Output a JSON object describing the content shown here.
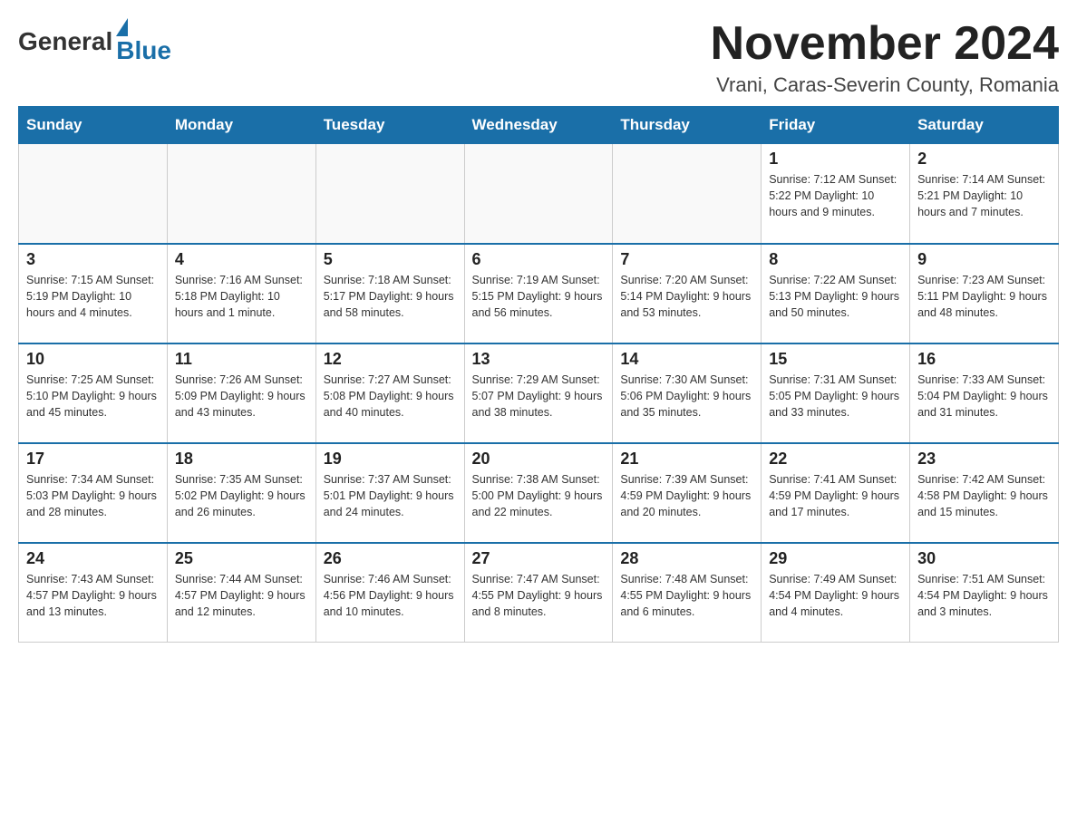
{
  "logo": {
    "general": "General",
    "blue": "Blue",
    "arrow": "▶"
  },
  "title": {
    "month": "November 2024",
    "location": "Vrani, Caras-Severin County, Romania"
  },
  "weekdays": [
    "Sunday",
    "Monday",
    "Tuesday",
    "Wednesday",
    "Thursday",
    "Friday",
    "Saturday"
  ],
  "weeks": [
    [
      {
        "day": "",
        "info": ""
      },
      {
        "day": "",
        "info": ""
      },
      {
        "day": "",
        "info": ""
      },
      {
        "day": "",
        "info": ""
      },
      {
        "day": "",
        "info": ""
      },
      {
        "day": "1",
        "info": "Sunrise: 7:12 AM\nSunset: 5:22 PM\nDaylight: 10 hours\nand 9 minutes."
      },
      {
        "day": "2",
        "info": "Sunrise: 7:14 AM\nSunset: 5:21 PM\nDaylight: 10 hours\nand 7 minutes."
      }
    ],
    [
      {
        "day": "3",
        "info": "Sunrise: 7:15 AM\nSunset: 5:19 PM\nDaylight: 10 hours\nand 4 minutes."
      },
      {
        "day": "4",
        "info": "Sunrise: 7:16 AM\nSunset: 5:18 PM\nDaylight: 10 hours\nand 1 minute."
      },
      {
        "day": "5",
        "info": "Sunrise: 7:18 AM\nSunset: 5:17 PM\nDaylight: 9 hours\nand 58 minutes."
      },
      {
        "day": "6",
        "info": "Sunrise: 7:19 AM\nSunset: 5:15 PM\nDaylight: 9 hours\nand 56 minutes."
      },
      {
        "day": "7",
        "info": "Sunrise: 7:20 AM\nSunset: 5:14 PM\nDaylight: 9 hours\nand 53 minutes."
      },
      {
        "day": "8",
        "info": "Sunrise: 7:22 AM\nSunset: 5:13 PM\nDaylight: 9 hours\nand 50 minutes."
      },
      {
        "day": "9",
        "info": "Sunrise: 7:23 AM\nSunset: 5:11 PM\nDaylight: 9 hours\nand 48 minutes."
      }
    ],
    [
      {
        "day": "10",
        "info": "Sunrise: 7:25 AM\nSunset: 5:10 PM\nDaylight: 9 hours\nand 45 minutes."
      },
      {
        "day": "11",
        "info": "Sunrise: 7:26 AM\nSunset: 5:09 PM\nDaylight: 9 hours\nand 43 minutes."
      },
      {
        "day": "12",
        "info": "Sunrise: 7:27 AM\nSunset: 5:08 PM\nDaylight: 9 hours\nand 40 minutes."
      },
      {
        "day": "13",
        "info": "Sunrise: 7:29 AM\nSunset: 5:07 PM\nDaylight: 9 hours\nand 38 minutes."
      },
      {
        "day": "14",
        "info": "Sunrise: 7:30 AM\nSunset: 5:06 PM\nDaylight: 9 hours\nand 35 minutes."
      },
      {
        "day": "15",
        "info": "Sunrise: 7:31 AM\nSunset: 5:05 PM\nDaylight: 9 hours\nand 33 minutes."
      },
      {
        "day": "16",
        "info": "Sunrise: 7:33 AM\nSunset: 5:04 PM\nDaylight: 9 hours\nand 31 minutes."
      }
    ],
    [
      {
        "day": "17",
        "info": "Sunrise: 7:34 AM\nSunset: 5:03 PM\nDaylight: 9 hours\nand 28 minutes."
      },
      {
        "day": "18",
        "info": "Sunrise: 7:35 AM\nSunset: 5:02 PM\nDaylight: 9 hours\nand 26 minutes."
      },
      {
        "day": "19",
        "info": "Sunrise: 7:37 AM\nSunset: 5:01 PM\nDaylight: 9 hours\nand 24 minutes."
      },
      {
        "day": "20",
        "info": "Sunrise: 7:38 AM\nSunset: 5:00 PM\nDaylight: 9 hours\nand 22 minutes."
      },
      {
        "day": "21",
        "info": "Sunrise: 7:39 AM\nSunset: 4:59 PM\nDaylight: 9 hours\nand 20 minutes."
      },
      {
        "day": "22",
        "info": "Sunrise: 7:41 AM\nSunset: 4:59 PM\nDaylight: 9 hours\nand 17 minutes."
      },
      {
        "day": "23",
        "info": "Sunrise: 7:42 AM\nSunset: 4:58 PM\nDaylight: 9 hours\nand 15 minutes."
      }
    ],
    [
      {
        "day": "24",
        "info": "Sunrise: 7:43 AM\nSunset: 4:57 PM\nDaylight: 9 hours\nand 13 minutes."
      },
      {
        "day": "25",
        "info": "Sunrise: 7:44 AM\nSunset: 4:57 PM\nDaylight: 9 hours\nand 12 minutes."
      },
      {
        "day": "26",
        "info": "Sunrise: 7:46 AM\nSunset: 4:56 PM\nDaylight: 9 hours\nand 10 minutes."
      },
      {
        "day": "27",
        "info": "Sunrise: 7:47 AM\nSunset: 4:55 PM\nDaylight: 9 hours\nand 8 minutes."
      },
      {
        "day": "28",
        "info": "Sunrise: 7:48 AM\nSunset: 4:55 PM\nDaylight: 9 hours\nand 6 minutes."
      },
      {
        "day": "29",
        "info": "Sunrise: 7:49 AM\nSunset: 4:54 PM\nDaylight: 9 hours\nand 4 minutes."
      },
      {
        "day": "30",
        "info": "Sunrise: 7:51 AM\nSunset: 4:54 PM\nDaylight: 9 hours\nand 3 minutes."
      }
    ]
  ]
}
